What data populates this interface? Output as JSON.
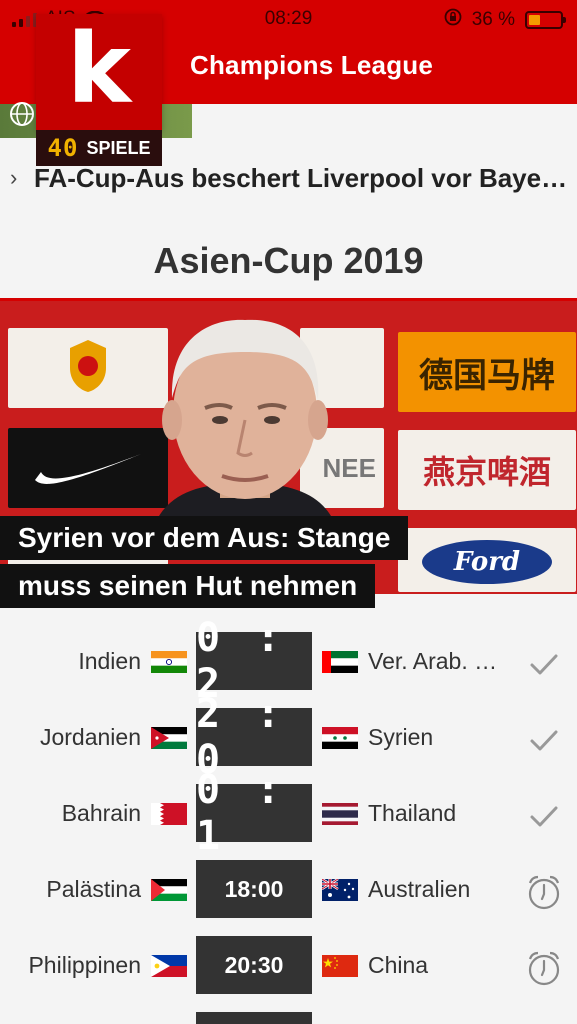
{
  "status_bar": {
    "carrier": "AIS",
    "time": "08:29",
    "battery_percent": "36 %",
    "battery_level": 0.36
  },
  "header": {
    "title": "Champions League",
    "logo_letter": "k",
    "games_count": "40",
    "games_label": "SPIELE"
  },
  "news": {
    "headline": "FA-Cup-Aus beschert Liverpool vor Bayern..."
  },
  "section": {
    "title": "Asien-Cup 2019"
  },
  "hero": {
    "caption_line1": "Syrien vor dem Aus: Stange",
    "caption_line2": "muss seinen Hut nehmen",
    "banner_text_1": "德国马牌",
    "banner_text_2": "燕京啤酒",
    "banner_text_3": "NEE",
    "banner_text_4": "Ford"
  },
  "matches": [
    {
      "home": "Indien",
      "away": "Ver. Arab. E...",
      "result": "0 : 2",
      "status": "finished",
      "home_flag": "india",
      "away_flag": "uae"
    },
    {
      "home": "Jordanien",
      "away": "Syrien",
      "result": "2 : 0",
      "status": "finished",
      "home_flag": "jordan",
      "away_flag": "syria"
    },
    {
      "home": "Bahrain",
      "away": "Thailand",
      "result": "0 : 1",
      "status": "finished",
      "home_flag": "bahrain",
      "away_flag": "thailand"
    },
    {
      "home": "Palästina",
      "away": "Australien",
      "result": "18:00",
      "status": "scheduled",
      "home_flag": "palestine",
      "away_flag": "australia"
    },
    {
      "home": "Philippinen",
      "away": "China",
      "result": "20:30",
      "status": "scheduled",
      "home_flag": "philippines",
      "away_flag": "china"
    }
  ],
  "colors": {
    "brand_red": "#d50000",
    "score_bg": "#333333",
    "badge_yellow": "#f2b200"
  }
}
